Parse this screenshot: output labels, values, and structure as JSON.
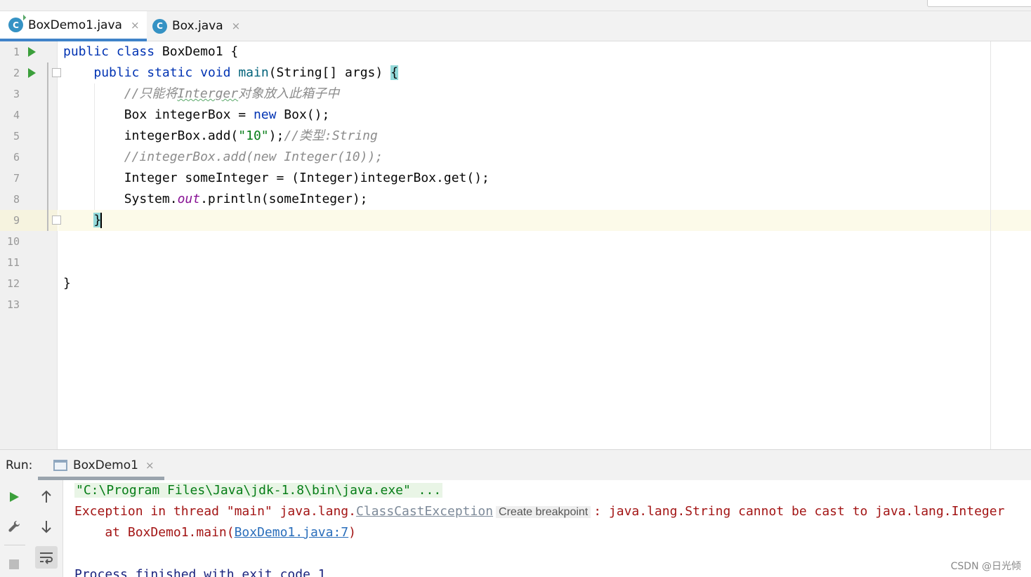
{
  "tabs": [
    {
      "label": "BoxDemo1.java",
      "icon": "java-class-icon",
      "icon_letter": "C",
      "active": true
    },
    {
      "label": "Box.java",
      "icon": "java-class-icon",
      "icon_letter": "C",
      "active": false
    }
  ],
  "tab_close_glyph": "×",
  "gutter": {
    "line_numbers": [
      "1",
      "2",
      "3",
      "4",
      "5",
      "6",
      "7",
      "8",
      "9",
      "10",
      "11",
      "12",
      "13"
    ]
  },
  "code": {
    "l1": {
      "kw1": "public",
      "kw2": "class",
      "name": " BoxDemo1 {"
    },
    "l2": {
      "kw1": "public",
      "kw2": "static",
      "kw3": "void",
      "fn": "main",
      "rest": "(String[] args) ",
      "brace": "{"
    },
    "l3": {
      "prefix": "//只能将",
      "typo": "Interger",
      "suffix": "对象放入此箱子中"
    },
    "l4": {
      "a": "Box integerBox = ",
      "kw": "new",
      "b": " Box();"
    },
    "l5": {
      "a": "integerBox.add(",
      "str": "\"10\"",
      "b": ");",
      "cmt": "//类型:String"
    },
    "l6": {
      "cmt": "//integerBox.add(new Integer(10));"
    },
    "l7": {
      "a": "Integer someInteger = (Integer)integerBox.get();"
    },
    "l8": {
      "a": "System.",
      "st": "out",
      "b": ".println(someInteger);"
    },
    "l9": {
      "brace": "}"
    },
    "l12": {
      "brace": "}"
    }
  },
  "run_panel": {
    "label": "Run:",
    "tab_label": "BoxDemo1",
    "console": {
      "cmd": "\"C:\\Program Files\\Java\\jdk-1.8\\bin\\java.exe\" ...",
      "err_prefix": "Exception in thread \"main\" java.lang.",
      "err_link": "ClassCastException",
      "hint": "Create breakpoint",
      "err_suffix": ": java.lang.String cannot be cast to java.lang.Integer",
      "at_prefix": "    at BoxDemo1.main(",
      "at_link": "BoxDemo1.java:7",
      "at_suffix": ")",
      "exit": "Process finished with exit code 1"
    }
  },
  "watermark": "CSDN @日光倾",
  "colors": {
    "keyword": "#0033b3",
    "string": "#067d17",
    "comment": "#8c8c8c",
    "static_field": "#871094",
    "error": "#a31515",
    "run_green": "#3b9f3b",
    "tab_accent": "#4083c9"
  }
}
